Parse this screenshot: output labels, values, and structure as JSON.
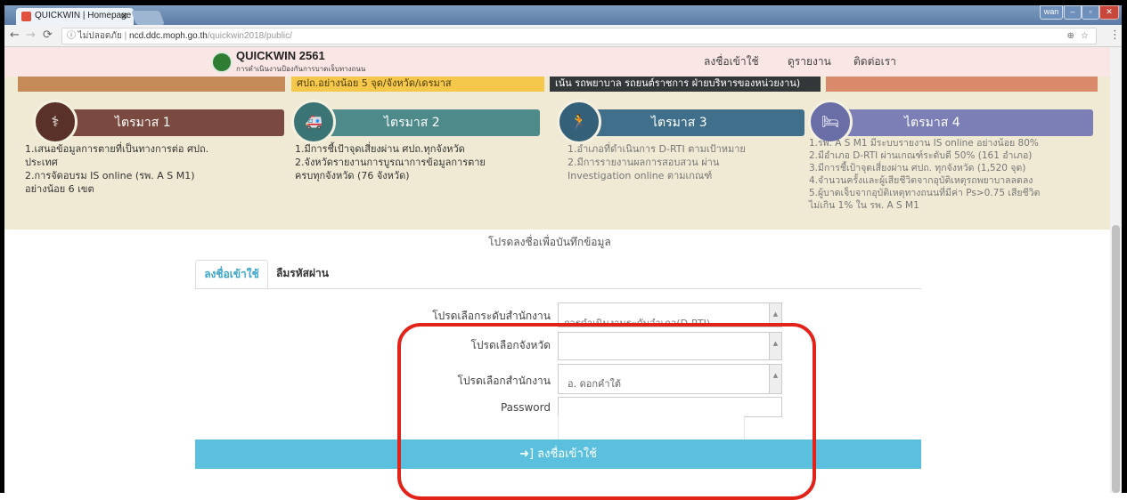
{
  "browser": {
    "tab_title": "QUICKWIN | Homepage",
    "tab_close": "×",
    "security_label": "ไม่ปลอดภัย",
    "url_host": "ncd.ddc.moph.go.th",
    "url_path": "/quickwin2018/public/",
    "window_user": "wan"
  },
  "site": {
    "brand": "QUICKWIN 2561",
    "subtitle": "การดำเนินงานป้องกันการบาดเจ็บทางถนน",
    "nav": [
      "ลงชื่อเข้าใช้",
      "ดูรายงาน",
      "ติดต่อเรา"
    ]
  },
  "banner": {
    "stripe2_text": "ศปถ.อย่างน้อย 5 จุด/จังหวัด/เดรมาส",
    "stripe3_text": "เน้น รถพยาบาล รถยนต์ราชการ ฝ่ายบริหารของหน่วยงาน)",
    "quarters": [
      {
        "label": "ไตรมาส 1",
        "color": "#7a4a40",
        "items": [
          "1.เสนอข้อมูลการตายที่เป็นทางการต่อ ศปถ.",
          "ประเทศ",
          "2.การจัดอบรม IS online (รพ. A S M1)",
          "อย่างน้อย 6 เขต"
        ]
      },
      {
        "label": "ไตรมาส 2",
        "color": "#4e8a8a",
        "items": [
          "1.มีการชี้เป้าจุดเสี่ยงผ่าน ศปถ.ทุกจังหวัด",
          "2.จังหวัดรายงานการบูรณาการข้อมูลการตาย",
          "ครบทุกจังหวัด (76 จังหวัด)"
        ]
      },
      {
        "label": "ไตรมาส 3",
        "color": "#3f6f8a",
        "items": [
          "1.อำเภอที่ดำเนินการ D-RTI ตามเป้าหมาย",
          "2.มีการรายงานผลการสอบสวน ผ่าน",
          "Investigation online ตามเกณฑ์"
        ]
      },
      {
        "label": "ไตรมาส 4",
        "color": "#7b7fb5",
        "items": [
          "1.รพ. A S M1 มีระบบรายงาน IS online อย่างน้อย 80%",
          "2.มีอำเภอ D-RTI ผ่านเกณฑ์ระดับดี 50% (161 อำเภอ)",
          "3.มีการชี้เป้าจุดเสี่ยงผ่าน ศปถ. ทุกจังหวัด (1,520 จุด)",
          "4.จำนวนครั้งและผู้เสียชีวิตจากอุบัติเหตุรถพยาบาลลดลง",
          "5.ผู้บาดเจ็บจากอุบัติเหตุทางถนนที่มีค่า Ps>0.75 เสียชีวิต",
          "ไม่เกิน 1% ใน รพ. A S M1"
        ]
      }
    ]
  },
  "login": {
    "heading": "โปรดลงชื่อเพื่อบันทึกข้อมูล",
    "tab_login": "ลงชื่อเข้าใช้",
    "tab_forgot": "ลืมรหัสผ่าน",
    "label_level": "โปรดเลือกระดับสำนักงาน",
    "value_level": "การดำเนินงานระดับอำเภอ(D-RTI)",
    "label_province": "โปรดเลือกจังหวัด",
    "value_province": "",
    "label_office": "โปรดเลือกสำนักงาน",
    "value_office": "อ. ดอกคำใต้",
    "label_password": "Password",
    "button": "ลงชื่อเข้าใช้"
  }
}
